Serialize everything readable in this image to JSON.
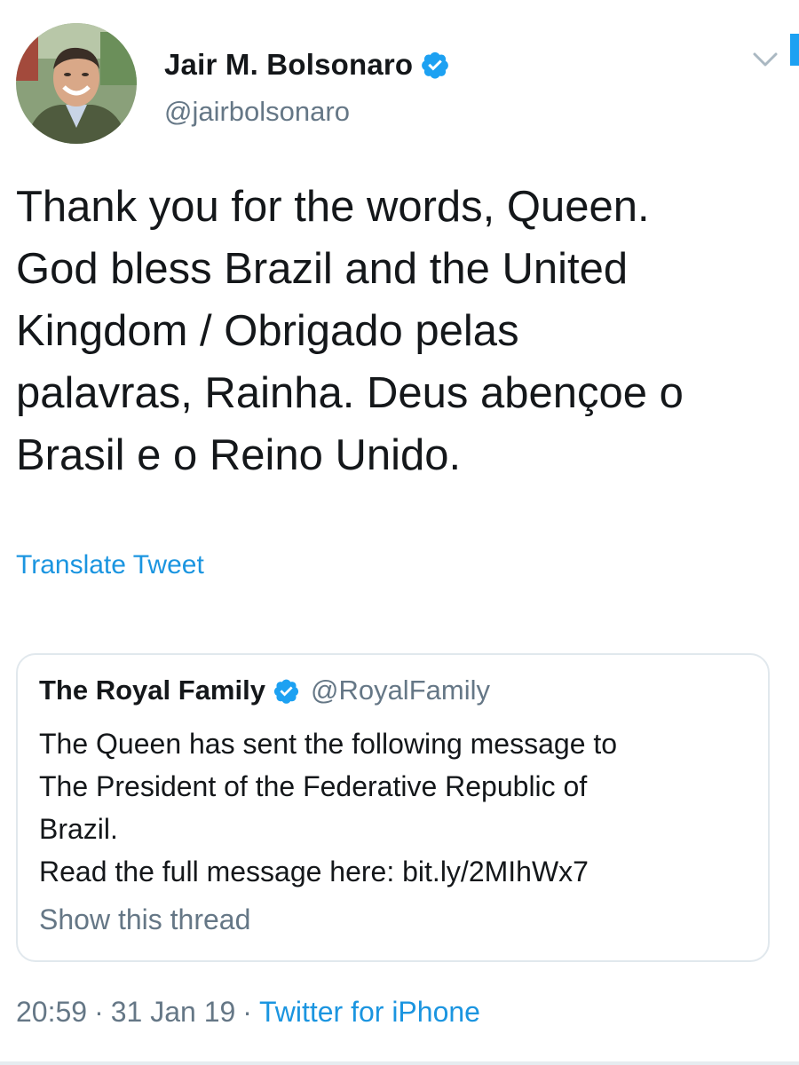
{
  "tweet": {
    "author": {
      "display_name": "Jair M. Bolsonaro",
      "handle": "@jairbolsonaro",
      "verified": true
    },
    "text_lines": [
      "Thank you for the words, Queen.",
      "God bless Brazil and the United",
      "Kingdom / Obrigado pelas",
      "palavras, Rainha. Deus abençoe o",
      "Brasil e o Reino Unido."
    ],
    "translate_label": "Translate Tweet",
    "quoted": {
      "display_name": "The Royal Family",
      "handle": "@RoyalFamily",
      "verified": true,
      "text_lines": [
        "The Queen has sent the following message to",
        "The President of the Federative Republic of",
        "Brazil.",
        "Read the full message here: bit.ly/2MIhWx7"
      ],
      "show_thread_label": "Show this thread"
    },
    "footer": {
      "time": "20:59",
      "separator": "·",
      "date": "31 Jan 19",
      "source": "Twitter for iPhone"
    }
  },
  "icons": {
    "verified": "verified-badge-icon",
    "menu": "chevron-down-icon"
  },
  "colors": {
    "link_blue": "#1b95e0",
    "verified_blue": "#1da1f2",
    "secondary_text": "#657786",
    "border": "#e1e8ed"
  }
}
